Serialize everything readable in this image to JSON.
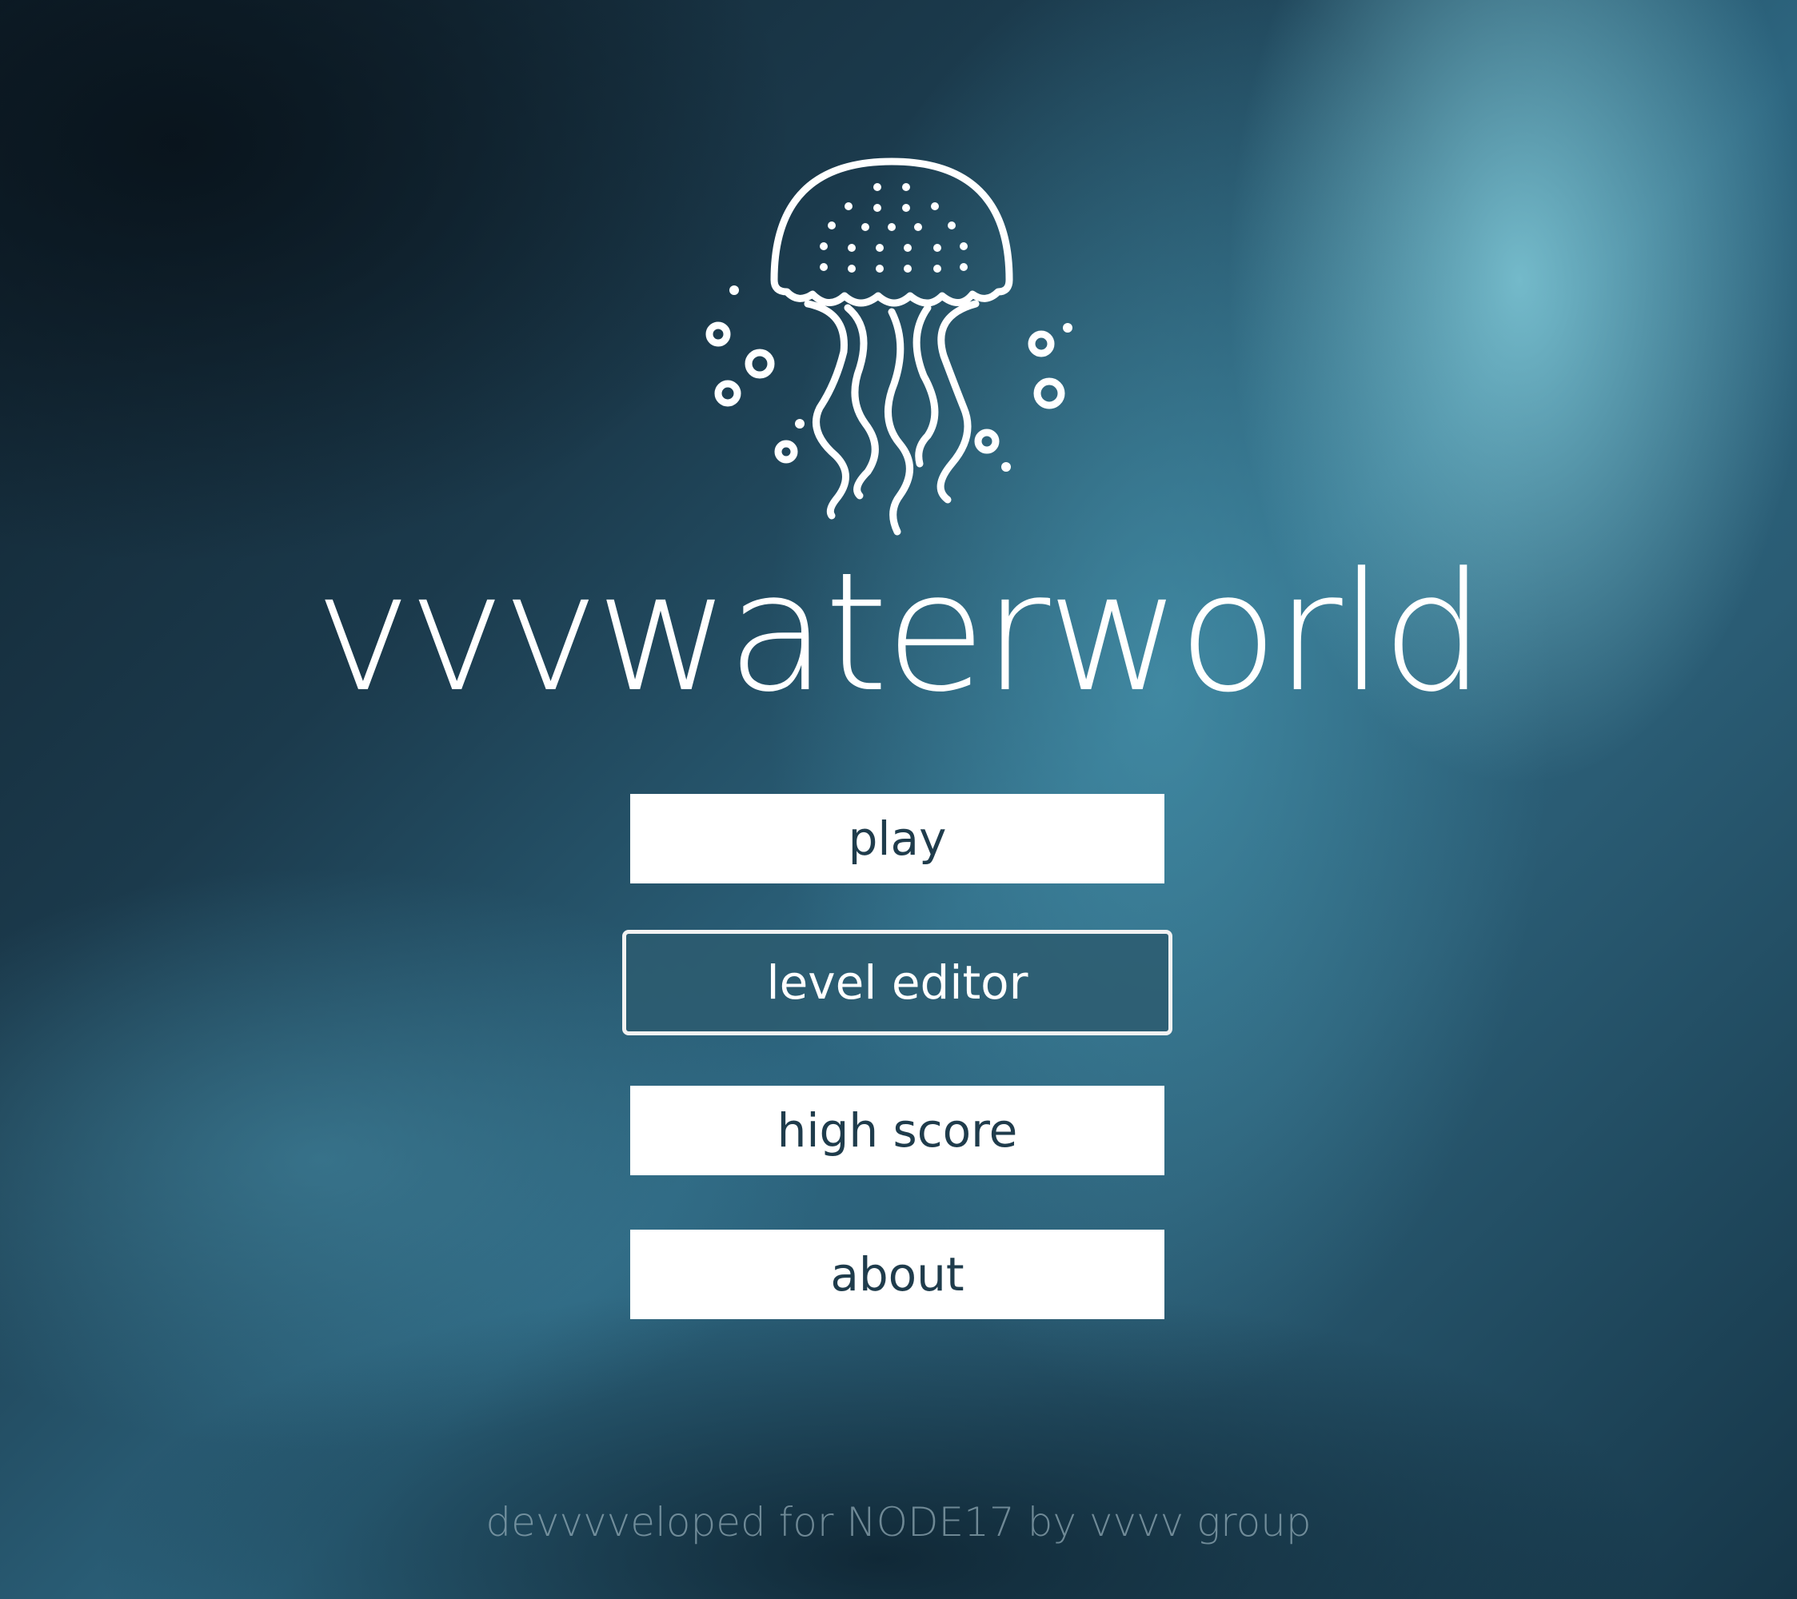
{
  "game": {
    "title": "vvvwaterworld",
    "logo_icon": "jellyfish-icon",
    "footer": "devvvveloped for NODE17 by vvvv group"
  },
  "menu": {
    "selected": "level_editor",
    "play_label": "play",
    "level_editor_label": "level editor",
    "high_score_label": "high score",
    "about_label": "about"
  },
  "colors": {
    "button_bg": "#ffffff",
    "button_text": "#1f3c4c",
    "selected_bg": "#2d5c70",
    "selected_border": "#f2f2f2",
    "footer_text": "#a0b9c3"
  }
}
